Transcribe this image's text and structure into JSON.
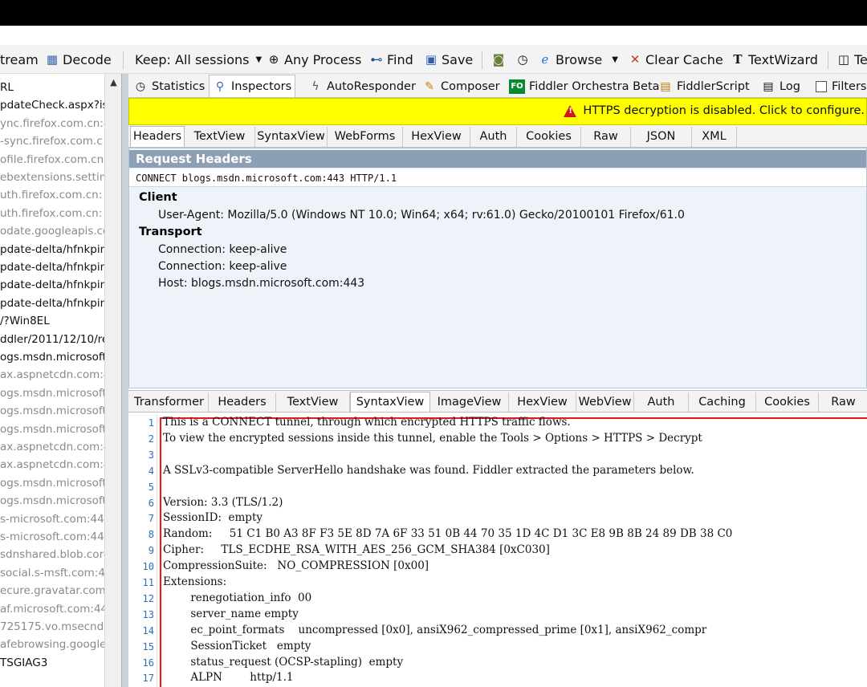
{
  "toolbar": {
    "items": [
      {
        "label": "tream",
        "icon": ""
      },
      {
        "label": "Decode",
        "icon": "decode-icon"
      },
      {
        "label": "Keep: All sessions",
        "icon": "",
        "dropdown": true
      },
      {
        "label": "Any Process",
        "icon": "crosshair-icon"
      },
      {
        "label": "Find",
        "icon": "binoculars-icon"
      },
      {
        "label": "Save",
        "icon": "save-icon"
      },
      {
        "label": "",
        "icon": "camera-icon"
      },
      {
        "label": "",
        "icon": "timer-icon"
      },
      {
        "label": "Browse",
        "icon": "browser-icon",
        "dropdown": true
      },
      {
        "label": "Clear Cache",
        "icon": "clear-cache-icon"
      },
      {
        "label": "TextWizard",
        "icon": "textwizard-icon"
      },
      {
        "label": "Te",
        "icon": "tearoff-icon"
      }
    ]
  },
  "sessions": {
    "rows": [
      {
        "text": "RL",
        "style": "dark"
      },
      {
        "text": "pdateCheck.aspx?is",
        "style": "dark"
      },
      {
        "text": "ync.firefox.com.cn:4",
        "style": "gray"
      },
      {
        "text": "-sync.firefox.com.c",
        "style": "gray"
      },
      {
        "text": "ofile.firefox.com.cn",
        "style": "gray"
      },
      {
        "text": "ebextensions.setting",
        "style": "gray"
      },
      {
        "text": "uth.firefox.com.cn:",
        "style": "gray"
      },
      {
        "text": "uth.firefox.com.cn:",
        "style": "gray"
      },
      {
        "text": "odate.googleapis.co",
        "style": "gray"
      },
      {
        "text": "pdate-delta/hfnkpim",
        "style": "dark"
      },
      {
        "text": "pdate-delta/hfnkpim",
        "style": "dark"
      },
      {
        "text": "pdate-delta/hfnkpim",
        "style": "dark"
      },
      {
        "text": "pdate-delta/hfnkpim",
        "style": "dark"
      },
      {
        "text": "/?Win8EL",
        "style": "dark"
      },
      {
        "text": "ddler/2011/12/10/re",
        "style": "dark"
      },
      {
        "text": "ogs.msdn.microsoft.",
        "style": "dark"
      },
      {
        "text": "ax.aspnetcdn.com:4",
        "style": "gray"
      },
      {
        "text": "ogs.msdn.microsoft.",
        "style": "gray"
      },
      {
        "text": "ogs.msdn.microsoft.",
        "style": "gray"
      },
      {
        "text": "ogs.msdn.microsoft.",
        "style": "gray"
      },
      {
        "text": "ax.aspnetcdn.com:4",
        "style": "gray"
      },
      {
        "text": "ax.aspnetcdn.com:4",
        "style": "gray"
      },
      {
        "text": "ogs.msdn.microsoft.",
        "style": "gray"
      },
      {
        "text": "ogs.msdn.microsoft.",
        "style": "gray"
      },
      {
        "text": "s-microsoft.com:443",
        "style": "gray"
      },
      {
        "text": "s-microsoft.com:443",
        "style": "gray"
      },
      {
        "text": "sdnshared.blob.core",
        "style": "gray"
      },
      {
        "text": "social.s-msft.com:4",
        "style": "gray"
      },
      {
        "text": "ecure.gravatar.com:",
        "style": "gray"
      },
      {
        "text": "af.microsoft.com:44",
        "style": "gray"
      },
      {
        "text": "725175.vo.msecnd.",
        "style": "gray"
      },
      {
        "text": "afebrowsing.googlea",
        "style": "gray"
      },
      {
        "text": "TSGIAG3",
        "style": "dark"
      }
    ]
  },
  "main_tabs": [
    {
      "label": "Statistics",
      "icon": "stopwatch-icon"
    },
    {
      "label": "Inspectors",
      "icon": "inspectors-icon",
      "active": true
    },
    {
      "label": "AutoResponder",
      "icon": "lightning-icon"
    },
    {
      "label": "Composer",
      "icon": "composer-icon"
    },
    {
      "label": "Fiddler Orchestra Beta",
      "icon": "fo-icon",
      "badge": "FO"
    },
    {
      "label": "FiddlerScript",
      "icon": "script-icon"
    },
    {
      "label": "Log",
      "icon": "log-icon"
    },
    {
      "label": "Filters",
      "icon": "checkbox-icon"
    }
  ],
  "warning": {
    "text": "HTTPS decryption is disabled. Click to configure.",
    "bg_color": "#ffff00",
    "icon_color": "#d0161b"
  },
  "request_tabs": [
    "Headers",
    "TextView",
    "SyntaxView",
    "WebForms",
    "HexView",
    "Auth",
    "Cookies",
    "Raw",
    "JSON",
    "XML"
  ],
  "request": {
    "title": "Request Headers",
    "request_line": "CONNECT blogs.msdn.microsoft.com:443 HTTP/1.1",
    "groups": [
      {
        "name": "Client",
        "items": [
          "User-Agent: Mozilla/5.0 (Windows NT 10.0; Win64; x64; rv:61.0) Gecko/20100101 Firefox/61.0"
        ]
      },
      {
        "name": "Transport",
        "items": [
          "Connection: keep-alive",
          "Connection: keep-alive",
          "Host: blogs.msdn.microsoft.com:443"
        ]
      }
    ]
  },
  "response_tabs": [
    "Transformer",
    "Headers",
    "TextView",
    "SyntaxView",
    "ImageView",
    "HexView",
    "WebView",
    "Auth",
    "Caching",
    "Cookies",
    "Raw"
  ],
  "code": {
    "lines": [
      "This is a CONNECT tunnel, through which encrypted HTTPS traffic flows.",
      "To view the encrypted sessions inside this tunnel, enable the Tools > Options > HTTPS > Decrypt",
      "",
      "A SSLv3-compatible ServerHello handshake was found. Fiddler extracted the parameters below.",
      "",
      "Version: 3.3 (TLS/1.2)",
      "SessionID:  empty",
      "Random:     51 C1 B0 A3 8F F3 5E 8D 7A 6F 33 51 0B 44 70 35 1D 4C D1 3C E8 9B 8B 24 89 DB 38 C0",
      "Cipher:     TLS_ECDHE_RSA_WITH_AES_256_GCM_SHA384 [0xC030]",
      "CompressionSuite:   NO_COMPRESSION [0x00]",
      "Extensions:",
      "        renegotiation_info  00",
      "        server_name empty",
      "        ec_point_formats    uncompressed [0x0], ansiX962_compressed_prime [0x1], ansiX962_compr",
      "        SessionTicket   empty",
      "        status_request (OCSP-stapling)  empty",
      "        ALPN        http/1.1"
    ]
  }
}
